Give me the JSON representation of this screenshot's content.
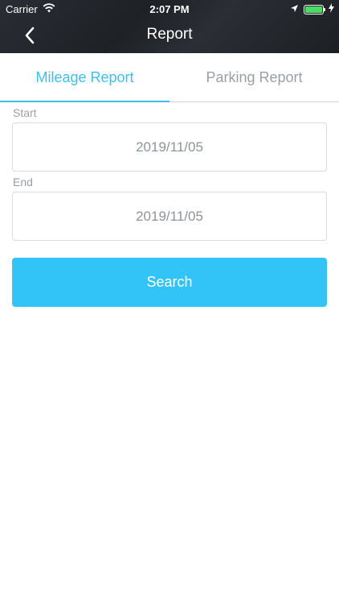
{
  "status_bar": {
    "carrier": "Carrier",
    "time": "2:07 PM"
  },
  "nav": {
    "title": "Report",
    "back_icon": "chevron-left-icon"
  },
  "tabs": [
    {
      "label": "Mileage Report",
      "active": true
    },
    {
      "label": "Parking Report",
      "active": false
    }
  ],
  "form": {
    "start_label": "Start",
    "start_value": "2019/11/05",
    "end_label": "End",
    "end_value": "2019/11/05",
    "search_label": "Search"
  },
  "colors": {
    "accent": "#3ec0ea",
    "button": "#33c4f7",
    "header": "#23262b",
    "muted_text": "#9aa0a5",
    "battery": "#4cd964"
  }
}
